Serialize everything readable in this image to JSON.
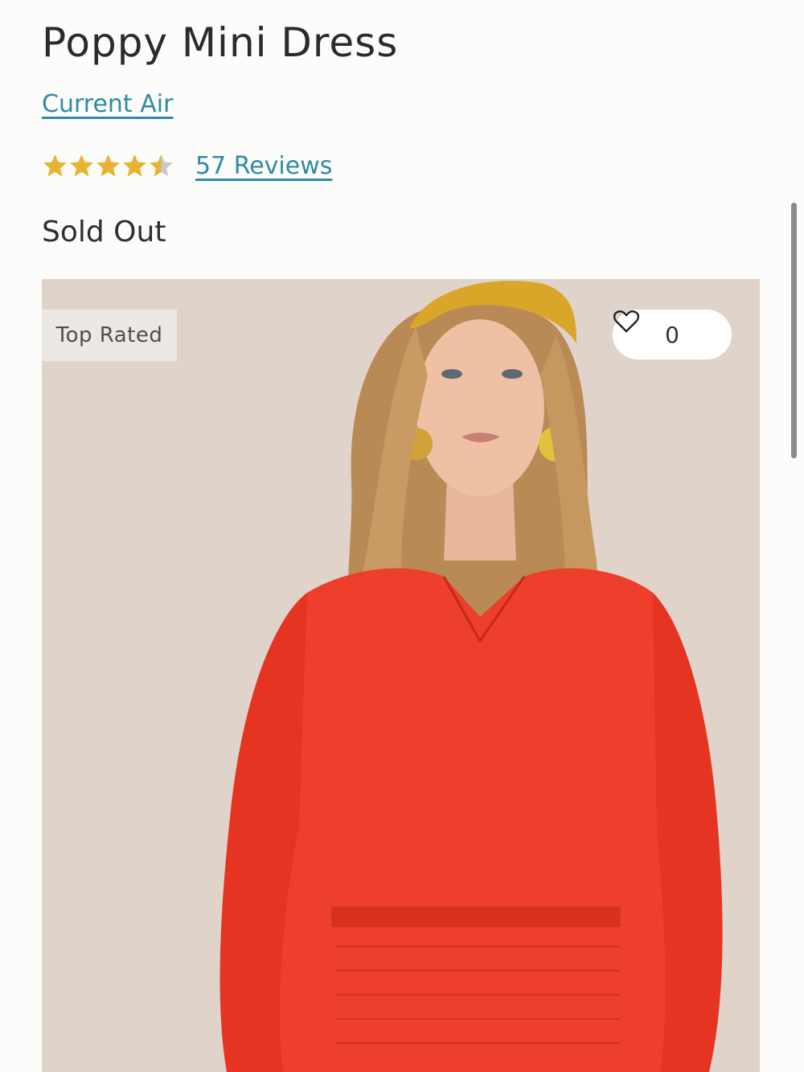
{
  "product": {
    "title": "Poppy Mini Dress",
    "brand": "Current Air",
    "rating": 4.5,
    "rating_max": 5,
    "reviews_label": "57 Reviews",
    "status": "Sold Out"
  },
  "image": {
    "badge": "Top Rated",
    "wishlist_count": "0",
    "wishlist_icon": "heart-outline-icon"
  },
  "colors": {
    "link": "#2f8ba5",
    "star": "#e8b233",
    "star_empty": "#c9c9c9",
    "dress": "#ee3e2c"
  }
}
